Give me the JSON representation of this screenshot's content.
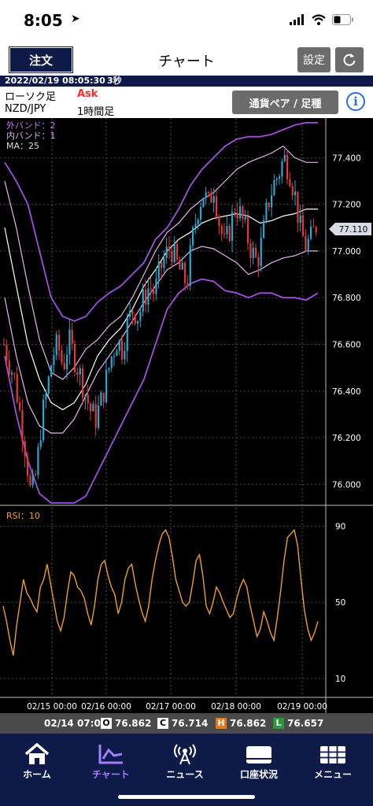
{
  "status_bar": {
    "time": "8:05"
  },
  "nav": {
    "order_label": "注文",
    "title": "チャート",
    "settings_label": "設定"
  },
  "info": {
    "datetime": "2022/02/19 08:05:30",
    "interval": "3秒",
    "candle_type": "ローソク足",
    "price_type": "Ask",
    "pair": "NZD/JPY",
    "timeframe": "1時間足",
    "pair_button": "通貨ペア / 足種"
  },
  "colors": {
    "navy": "#0e1a48",
    "ask": "#ff2a2a",
    "up": "#2ba6cf",
    "down": "#e03a3a",
    "rsi": "#f0a020",
    "outer_band": "#a050e0",
    "inner_band": "#e8b0f0",
    "ma": "#ffffff",
    "active_tab": "#a67cff"
  },
  "chart_data": [
    {
      "type": "candlestick",
      "legend": [
        "外バンド：2",
        "内バンド：1",
        "MA：25"
      ],
      "y_ticks": [
        "77.400",
        "77.200",
        "77.000",
        "76.800",
        "76.600",
        "76.400",
        "76.200",
        "76.000"
      ],
      "y_tick_values": [
        77.4,
        77.2,
        77.0,
        76.8,
        76.6,
        76.4,
        76.2,
        76.0
      ],
      "ylim": [
        75.91,
        77.57
      ],
      "x_ticks": [
        "02/15 00:00",
        "02/16 00:00",
        "02/17 00:00",
        "02/18 00:00",
        "02/19 00:00"
      ],
      "current_price": "77.110",
      "close_series": [
        76.6,
        76.52,
        76.45,
        76.3,
        76.15,
        75.95,
        76.05,
        76.28,
        76.4,
        76.55,
        76.6,
        76.5,
        76.62,
        76.55,
        76.48,
        76.4,
        76.32,
        76.28,
        76.35,
        76.45,
        76.55,
        76.62,
        76.58,
        76.7,
        76.75,
        76.72,
        76.8,
        76.85,
        76.82,
        76.92,
        76.98,
        77.02,
        76.95,
        76.9,
        76.86,
        77.05,
        77.18,
        77.25,
        77.2,
        77.28,
        77.12,
        77.02,
        77.1,
        77.2,
        77.15,
        77.08,
        77.0,
        76.95,
        77.05,
        77.2,
        77.28,
        77.33,
        77.4,
        77.35,
        77.25,
        77.1,
        77.02,
        77.05,
        77.11
      ],
      "outer_upper": [
        77.38,
        77.3,
        77.2,
        77.0,
        76.8,
        76.72,
        76.7,
        76.72,
        76.78,
        76.82,
        76.85,
        76.9,
        76.95,
        77.05,
        77.1,
        77.18,
        77.28,
        77.35,
        77.4,
        77.45,
        77.48,
        77.49,
        77.49,
        77.5,
        77.52,
        77.54,
        77.55,
        77.55
      ],
      "outer_lower": [
        76.55,
        76.3,
        76.1,
        75.96,
        75.92,
        75.92,
        75.92,
        75.95,
        76.05,
        76.15,
        76.25,
        76.35,
        76.45,
        76.6,
        76.75,
        76.82,
        76.86,
        76.88,
        76.87,
        76.83,
        76.82,
        76.8,
        76.82,
        76.82,
        76.8,
        76.8,
        76.79,
        76.82
      ],
      "inner_upper": [
        77.3,
        77.1,
        76.85,
        76.62,
        76.48,
        76.45,
        76.5,
        76.58,
        76.62,
        76.68,
        76.72,
        76.8,
        76.9,
        77.0,
        77.08,
        77.12,
        77.18,
        77.22,
        77.25,
        77.3,
        77.35,
        77.38,
        77.4,
        77.42,
        77.45,
        77.4,
        77.38,
        77.38
      ],
      "inner_lower": [
        76.8,
        76.55,
        76.35,
        76.25,
        76.22,
        76.22,
        76.28,
        76.38,
        76.48,
        76.55,
        76.62,
        76.7,
        76.78,
        76.85,
        76.92,
        76.95,
        77.0,
        77.02,
        77.01,
        76.98,
        76.95,
        76.9,
        76.92,
        76.95,
        76.97,
        76.98,
        77.0,
        77.0
      ],
      "ma": [
        77.1,
        76.85,
        76.6,
        76.45,
        76.35,
        76.32,
        76.35,
        76.43,
        76.55,
        76.62,
        76.67,
        76.75,
        76.85,
        76.92,
        77.0,
        77.05,
        77.08,
        77.12,
        77.14,
        77.15,
        77.16,
        77.15,
        77.12,
        77.13,
        77.15,
        77.16,
        77.18,
        77.18
      ]
    },
    {
      "type": "line",
      "title": "RSI：10",
      "y_ticks": [
        "90",
        "50",
        "10"
      ],
      "y_tick_values": [
        90,
        50,
        10
      ],
      "ylim": [
        0,
        101
      ],
      "x_ticks": [
        "02/15 00:00",
        "02/16 00:00",
        "02/17 00:00",
        "02/18 00:00",
        "02/19 00:00"
      ],
      "values": [
        48,
        40,
        30,
        22,
        38,
        50,
        62,
        55,
        52,
        48,
        45,
        58,
        62,
        70,
        60,
        50,
        40,
        35,
        42,
        55,
        66,
        64,
        58,
        56,
        52,
        44,
        38,
        48,
        62,
        70,
        72,
        64,
        58,
        54,
        44,
        50,
        62,
        68,
        70,
        60,
        52,
        45,
        40,
        48,
        62,
        72,
        80,
        86,
        88,
        84,
        74,
        62,
        56,
        50,
        48,
        50,
        60,
        72,
        75,
        64,
        48,
        44,
        50,
        58,
        55,
        50,
        46,
        42,
        44,
        52,
        58,
        62,
        58,
        48,
        40,
        32,
        36,
        45,
        40,
        34,
        30,
        42,
        56,
        72,
        84,
        86,
        88,
        80,
        62,
        46,
        36,
        30,
        34,
        40
      ]
    }
  ],
  "ohlc": {
    "date": "02/14 07:00",
    "items": [
      {
        "key": "O",
        "value": "76.862",
        "color": "#4a4a4a"
      },
      {
        "key": "C",
        "value": "76.714",
        "color": "#4a4a4a"
      },
      {
        "key": "H",
        "value": "76.862",
        "color": "#e07a20"
      },
      {
        "key": "L",
        "value": "76.657",
        "color": "#2a9a3a"
      }
    ]
  },
  "tabs": [
    {
      "label": "ホーム",
      "icon": "home-icon"
    },
    {
      "label": "チャート",
      "icon": "chart-icon",
      "active": true
    },
    {
      "label": "ニュース",
      "icon": "news-icon"
    },
    {
      "label": "口座状況",
      "icon": "account-icon"
    },
    {
      "label": "メニュー",
      "icon": "menu-icon"
    }
  ]
}
